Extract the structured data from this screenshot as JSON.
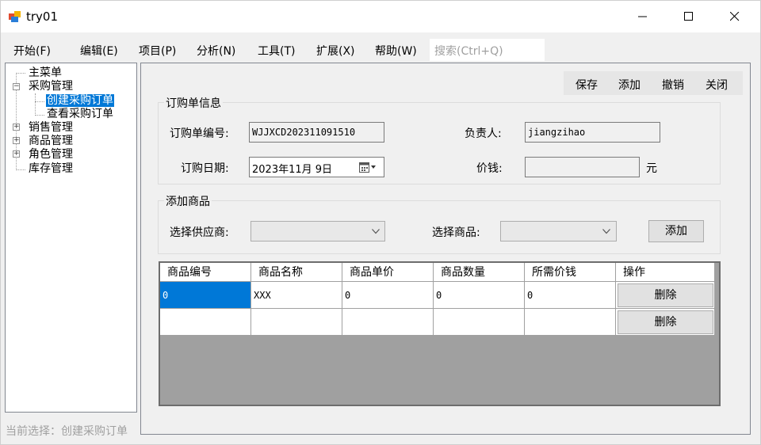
{
  "window": {
    "title": "try01"
  },
  "menu": [
    {
      "label": "开始(F)"
    },
    {
      "label": "编辑(E)"
    },
    {
      "label": "项目(P)"
    },
    {
      "label": "分析(N)"
    },
    {
      "label": "工具(T)"
    },
    {
      "label": "扩展(X)"
    },
    {
      "label": "帮助(W)"
    }
  ],
  "search": {
    "placeholder": "搜索(Ctrl+Q)"
  },
  "tree": {
    "items": [
      {
        "label": "主菜单"
      },
      {
        "label": "采购管理"
      },
      {
        "label": "创建采购订单"
      },
      {
        "label": "查看采购订单"
      },
      {
        "label": "销售管理"
      },
      {
        "label": "商品管理"
      },
      {
        "label": "角色管理"
      },
      {
        "label": "库存管理"
      }
    ]
  },
  "status": {
    "text": "当前选择：创建采购订单"
  },
  "toolbar": {
    "save": "保存",
    "add": "添加",
    "undo": "撤销",
    "close": "关闭"
  },
  "order_info": {
    "title": "订购单信息",
    "order_no_label": "订购单编号:",
    "order_no_value": "WJJXCD202311091510",
    "owner_label": "负责人:",
    "owner_value": "jiangzihao",
    "date_label": "订购日期:",
    "date_value": "2023年11月 9日",
    "price_label": "价钱:",
    "price_value": "",
    "currency": "元"
  },
  "add_goods": {
    "title": "添加商品",
    "supplier_label": "选择供应商:",
    "supplier_value": "",
    "goods_label": "选择商品:",
    "goods_value": "",
    "add_button": "添加"
  },
  "grid": {
    "columns": [
      "商品编号",
      "商品名称",
      "商品单价",
      "商品数量",
      "所需价钱",
      "操作"
    ],
    "rows": [
      {
        "id": "0",
        "name": "XXX",
        "unit_price": "0",
        "qty": "0",
        "total": "0",
        "action": "删除"
      },
      {
        "id": "",
        "name": "",
        "unit_price": "",
        "qty": "",
        "total": "",
        "action": "删除"
      }
    ]
  },
  "colors": {
    "selection": "#0078d7",
    "panel_bg": "#f0f0f0",
    "grid_bg": "#a0a0a0"
  }
}
